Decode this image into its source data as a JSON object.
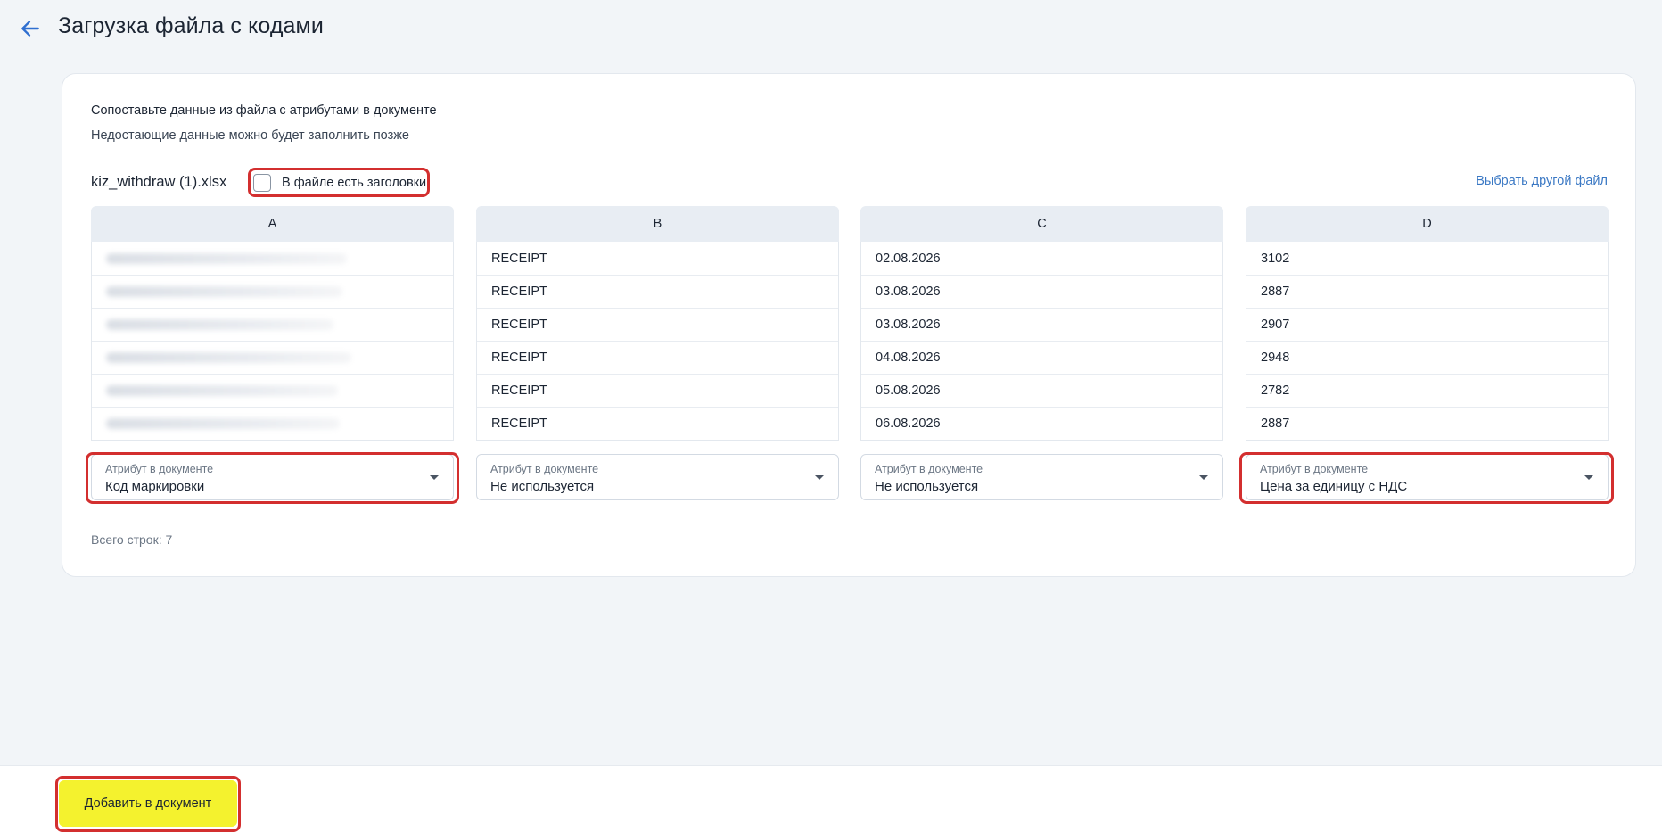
{
  "header": {
    "title": "Загрузка файла с кодами",
    "back_icon": "arrow-left-icon"
  },
  "intro": {
    "title": "Сопоставьте данные из файла с атрибутами в документе",
    "subtitle": "Недостающие данные можно будет заполнить позже"
  },
  "file": {
    "name": "kiz_withdraw (1).xlsx",
    "headers_checkbox_label": "В файле есть заголовки",
    "headers_checked": false,
    "change_file_label": "Выбрать другой файл"
  },
  "columns": [
    {
      "header": "A",
      "cells": [
        "",
        "",
        "",
        "",
        "",
        ""
      ],
      "blurred": true,
      "attribute_label": "Атрибут в документе",
      "attribute_value": "Код маркировки"
    },
    {
      "header": "B",
      "cells": [
        "RECEIPT",
        "RECEIPT",
        "RECEIPT",
        "RECEIPT",
        "RECEIPT",
        "RECEIPT"
      ],
      "attribute_label": "Атрибут в документе",
      "attribute_value": "Не используется"
    },
    {
      "header": "C",
      "cells": [
        "02.08.2026",
        "03.08.2026",
        "03.08.2026",
        "04.08.2026",
        "05.08.2026",
        "06.08.2026"
      ],
      "attribute_label": "Атрибут в документе",
      "attribute_value": "Не используется"
    },
    {
      "header": "D",
      "cells": [
        "3102",
        "2887",
        "2907",
        "2948",
        "2782",
        "2887"
      ],
      "attribute_label": "Атрибут в документе",
      "attribute_value": "Цена за единицу с НДС"
    }
  ],
  "summary": {
    "total_rows": "Всего строк: 7"
  },
  "footer": {
    "submit_label": "Добавить в документ"
  },
  "colors": {
    "accent": "#f4f22e",
    "link": "#3a78c4",
    "highlight": "#d32f2f"
  }
}
